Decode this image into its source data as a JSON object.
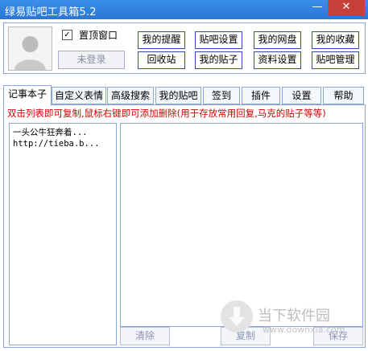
{
  "window": {
    "title": "绿易贴吧工具箱5.2",
    "minimize": "—",
    "close": "✕"
  },
  "header": {
    "avatar_icon": "default-user-avatar-icon",
    "checkbox": {
      "label": "置顶窗口",
      "checked": true,
      "mark": "✓"
    },
    "login_button": "未登录",
    "links": [
      "我的提醒",
      "贴吧设置",
      "我的网盘",
      "我的收藏",
      "回收站",
      "我的贴子",
      "资料设置",
      "贴吧管理"
    ]
  },
  "tabs": [
    "记事本子",
    "自定义表情",
    "高级搜索",
    "我的贴吧",
    "签到",
    "插件",
    "设置",
    "帮助"
  ],
  "notepad": {
    "instruction": "双击列表即可复制,鼠标右键即可添加删除(用于存放常用回复,马克的贴子等等)",
    "items": [
      "一头公牛狂奔着...",
      "http://tieba.b..."
    ],
    "buttons": {
      "clear": "清除",
      "copy": "复制",
      "save": "保存"
    }
  },
  "watermark": {
    "text": "当下软件园",
    "url": "www.downxia.com",
    "icon": "download-arrow-icon"
  }
}
